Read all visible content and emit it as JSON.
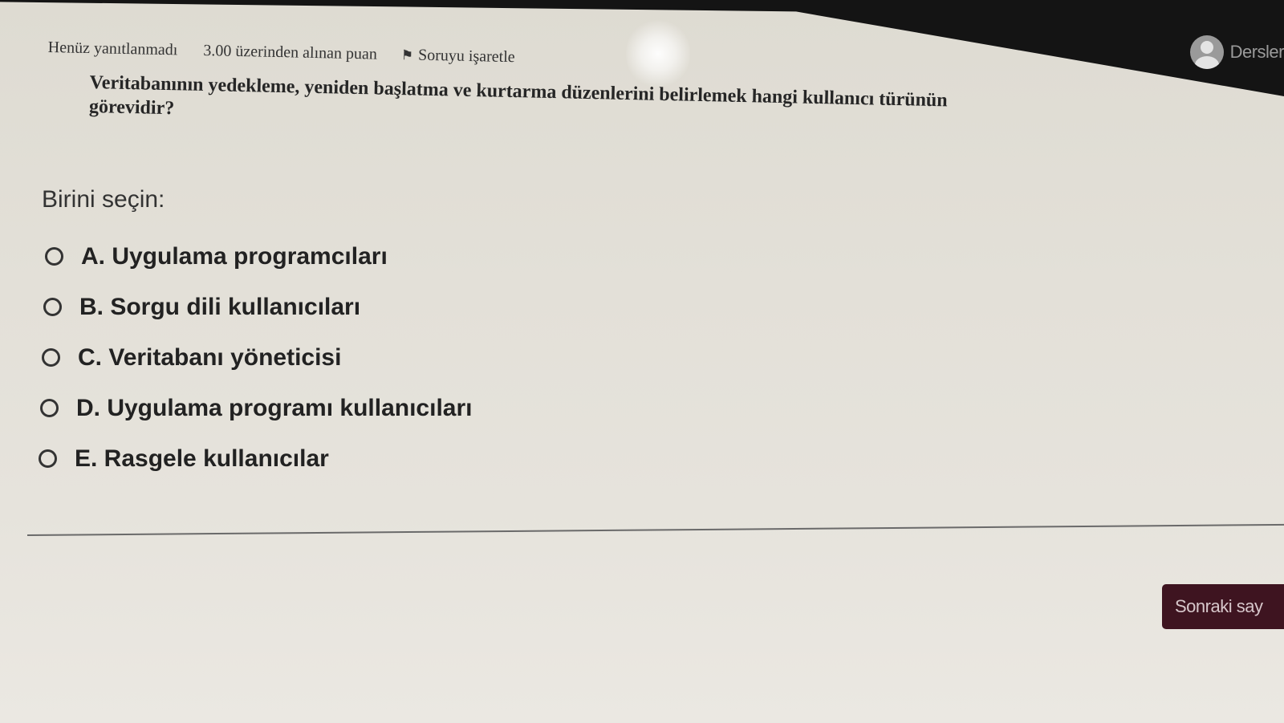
{
  "navbar": {
    "user_menu_text": "Dersler"
  },
  "question_info": {
    "state": "Henüz yanıtlanmadı",
    "grade": "3.00 üzerinden alınan puan",
    "flag_label": "Soruyu işaretle",
    "flag_icon": "flag-icon"
  },
  "question": {
    "text": "Veritabanının yedekleme, yeniden başlatma ve kurtarma düzenlerini belirlemek hangi kullanıcı türünün görevidir?"
  },
  "answer_prompt": "Birini seçin:",
  "answers": [
    {
      "label": "A. Uygulama programcıları",
      "selected": false
    },
    {
      "label": "B. Sorgu dili kullanıcıları",
      "selected": false
    },
    {
      "label": "C. Veritabanı yöneticisi",
      "selected": false
    },
    {
      "label": "D. Uygulama programı kullanıcıları",
      "selected": false
    },
    {
      "label": "E. Rasgele kullanıcılar",
      "selected": false
    }
  ],
  "footer": {
    "next_button_label": "Sonraki say"
  },
  "colors": {
    "navbar_bg": "#141414",
    "next_button_bg": "#3e1420",
    "page_bg": "#e3e0d8"
  }
}
